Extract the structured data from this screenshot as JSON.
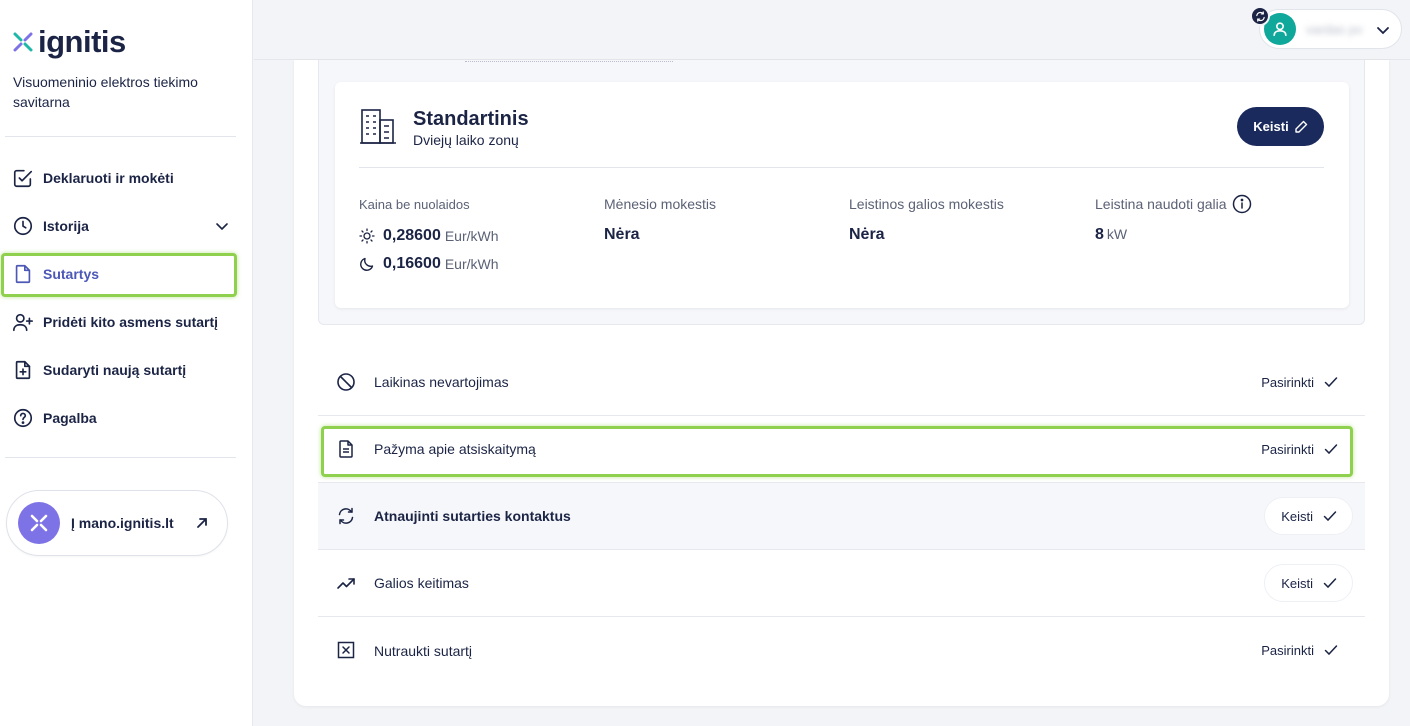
{
  "brand": {
    "logo_text": "ignitis",
    "subtitle": "Visuomeninio elektros tiekimo savitarna"
  },
  "nav": {
    "items": [
      {
        "label": "Deklaruoti ir mokėti",
        "icon": "checkbox-edit-icon"
      },
      {
        "label": "Istorija",
        "icon": "clock-icon",
        "expandable": true
      },
      {
        "label": "Sutartys",
        "icon": "document-icon",
        "active": true
      },
      {
        "label": "Pridėti kito asmens sutartį",
        "icon": "user-add-icon"
      },
      {
        "label": "Sudaryti naują sutartį",
        "icon": "file-plus-icon"
      },
      {
        "label": "Pagalba",
        "icon": "help-circle-icon"
      }
    ]
  },
  "external_link": {
    "label": "Į mano.ignitis.lt",
    "icon": "external-arrow-icon"
  },
  "user": {
    "name": "vardas pv"
  },
  "plan": {
    "title": "Standartinis",
    "subtitle": "Dviejų laiko zonų",
    "change_label": "Keisti",
    "price_label": "Kaina be nuolaidos",
    "day_price": "0,28600",
    "night_price": "0,16600",
    "price_unit": "Eur/kWh",
    "monthly_fee_label": "Mėnesio mokestis",
    "monthly_fee_value": "Nėra",
    "power_fee_label": "Leistinos galios mokestis",
    "power_fee_value": "Nėra",
    "allowed_power_label": "Leistina naudoti galia",
    "allowed_power_value": "8",
    "allowed_power_unit": "kW"
  },
  "actions": [
    {
      "label": "Laikinas nevartojimas",
      "button": "Pasirinkti",
      "icon": "block-icon"
    },
    {
      "label": "Pažyma apie atsiskaitymą",
      "button": "Pasirinkti",
      "icon": "document-text-icon",
      "highlighted": true
    },
    {
      "label": "Atnaujinti sutarties kontaktus",
      "button": "Keisti",
      "icon": "refresh-icon"
    },
    {
      "label": "Galios keitimas",
      "button": "Keisti",
      "icon": "trending-up-icon"
    },
    {
      "label": "Nutraukti sutartį",
      "button": "Pasirinkti",
      "icon": "close-box-icon"
    }
  ],
  "colors": {
    "accent": "#4c57b6",
    "navy": "#1b2a5c",
    "highlight": "#8fd14f",
    "avatar": "#10a89a",
    "badge": "#7e73e6"
  }
}
